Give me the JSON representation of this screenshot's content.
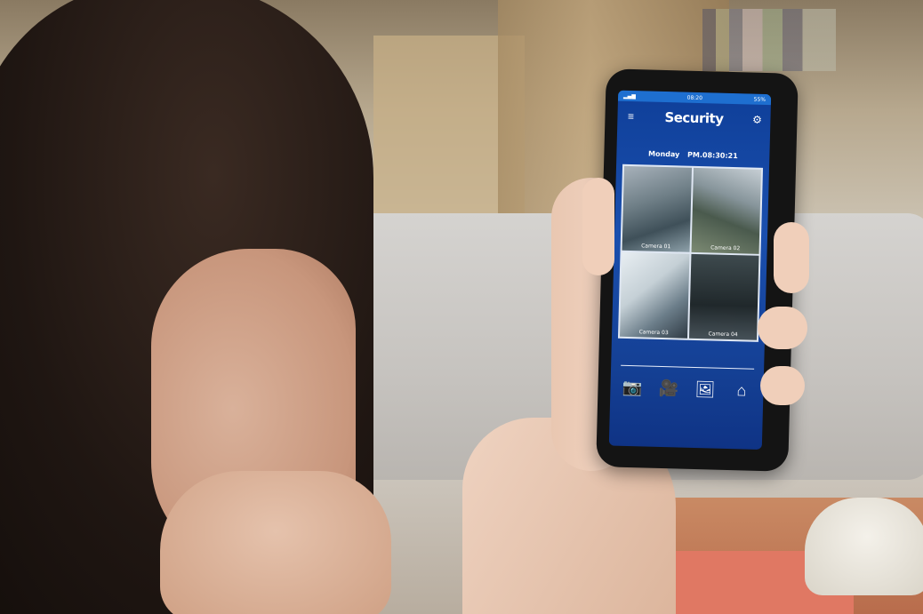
{
  "status_bar": {
    "signal": "▂▄▆",
    "time": "08:20",
    "battery": "55%"
  },
  "app": {
    "title": "Security",
    "day": "Monday",
    "clock": "PM.08:30:21"
  },
  "cameras": [
    {
      "label": "Camera 01"
    },
    {
      "label": "Camera 02"
    },
    {
      "label": "Camera 03"
    },
    {
      "label": "Camera 04"
    }
  ],
  "icons": {
    "menu": "≡",
    "settings": "⚙",
    "photo": "📷",
    "video": "🎥",
    "gallery": "🖼",
    "home": "⌂"
  }
}
